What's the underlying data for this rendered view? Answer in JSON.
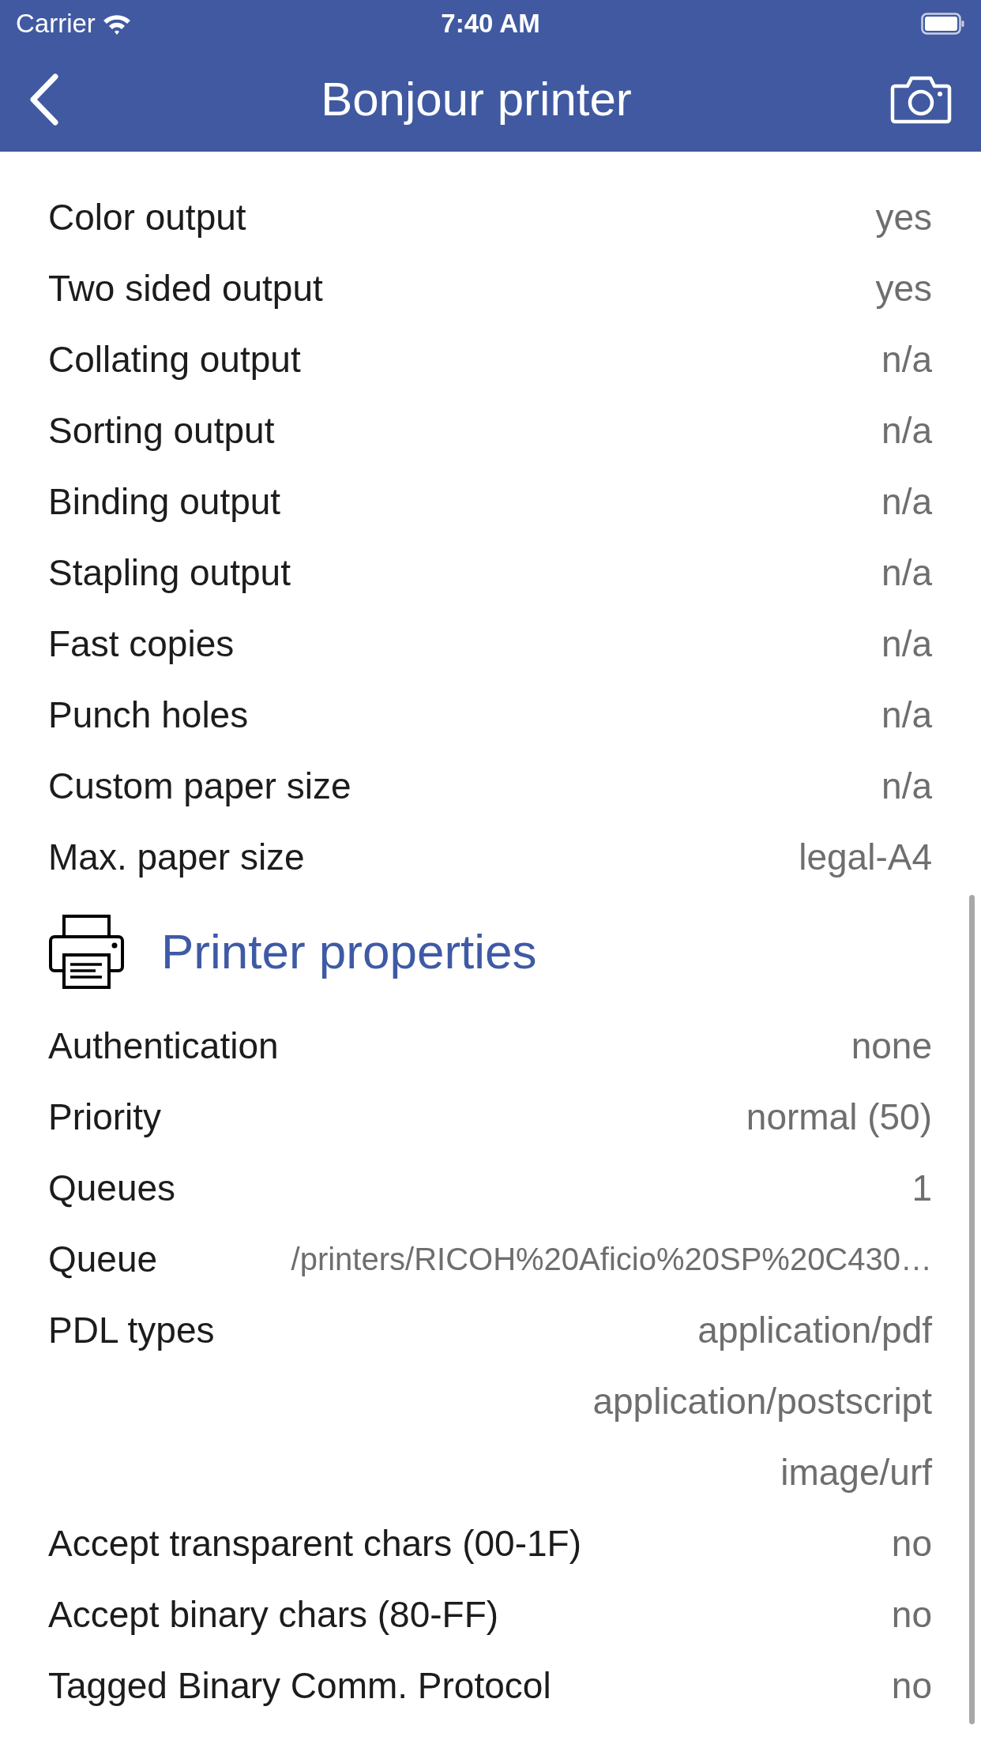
{
  "status_bar": {
    "carrier": "Carrier",
    "time": "7:40 AM"
  },
  "nav": {
    "title": "Bonjour printer"
  },
  "sections": [
    {
      "rows": [
        {
          "label": "Color output",
          "values": [
            "yes"
          ]
        },
        {
          "label": "Two sided output",
          "values": [
            "yes"
          ]
        },
        {
          "label": "Collating output",
          "values": [
            "n/a"
          ]
        },
        {
          "label": "Sorting output",
          "values": [
            "n/a"
          ]
        },
        {
          "label": "Binding output",
          "values": [
            "n/a"
          ]
        },
        {
          "label": "Stapling output",
          "values": [
            "n/a"
          ]
        },
        {
          "label": "Fast copies",
          "values": [
            "n/a"
          ]
        },
        {
          "label": "Punch holes",
          "values": [
            "n/a"
          ]
        },
        {
          "label": "Custom paper size",
          "values": [
            "n/a"
          ]
        },
        {
          "label": "Max. paper size",
          "values": [
            "legal-A4"
          ]
        }
      ]
    },
    {
      "title": "Printer properties",
      "rows": [
        {
          "label": "Authentication",
          "values": [
            "none"
          ]
        },
        {
          "label": "Priority",
          "values": [
            "normal (50)"
          ]
        },
        {
          "label": "Queues",
          "values": [
            "1"
          ]
        },
        {
          "label": "Queue",
          "values": [
            "/printers/RICOH%20Aficio%20SP%20C430…"
          ]
        },
        {
          "label": "PDL types",
          "values": [
            "application/pdf",
            "application/postscript",
            "image/urf"
          ]
        },
        {
          "label": "Accept transparent chars (00-1F)",
          "values": [
            "no"
          ]
        },
        {
          "label": "Accept binary chars (80-FF)",
          "values": [
            "no"
          ]
        },
        {
          "label": "Tagged Binary Comm. Protocol",
          "values": [
            "no"
          ]
        }
      ]
    }
  ]
}
